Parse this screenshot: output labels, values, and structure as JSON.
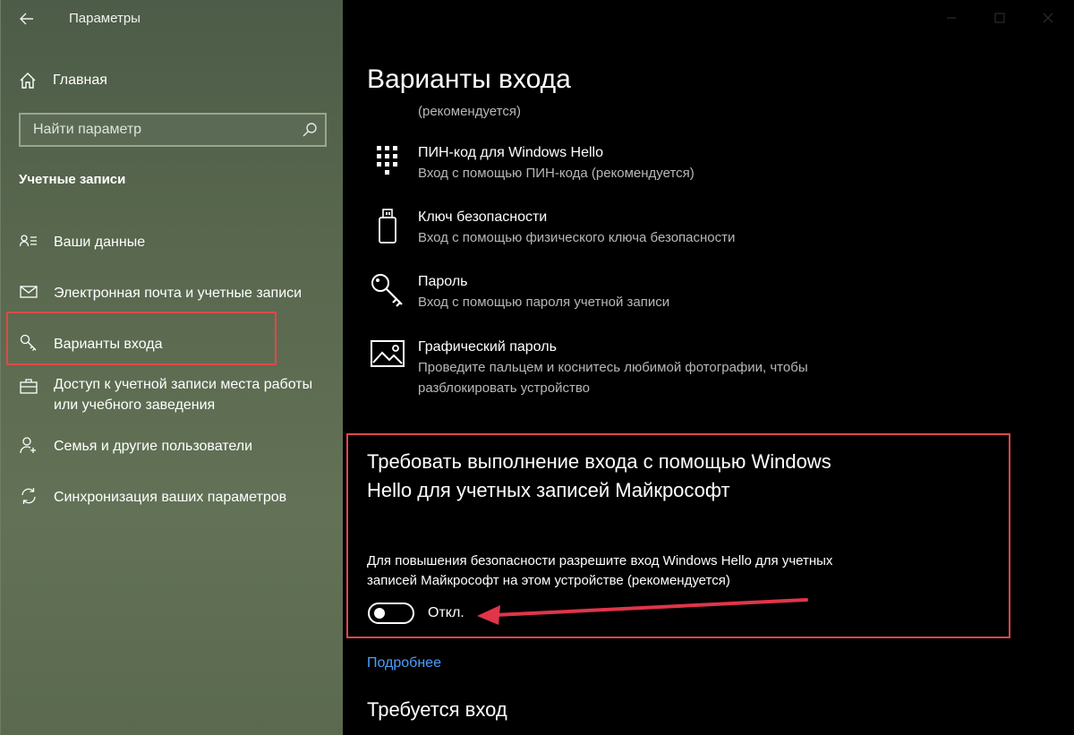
{
  "window": {
    "title": "Параметры"
  },
  "sidebar": {
    "home_label": "Главная",
    "search_placeholder": "Найти параметр",
    "section_title": "Учетные записи",
    "items": [
      {
        "label": "Ваши данные",
        "icon": "person-card-icon"
      },
      {
        "label": "Электронная почта и учетные записи",
        "icon": "mail-icon"
      },
      {
        "label": "Варианты входа",
        "icon": "key-icon",
        "selected": true
      },
      {
        "label": "Доступ к учетной записи места работы или учебного заведения",
        "icon": "briefcase-icon"
      },
      {
        "label": "Семья и другие пользователи",
        "icon": "person-add-icon"
      },
      {
        "label": "Синхронизация ваших параметров",
        "icon": "sync-icon"
      }
    ]
  },
  "main": {
    "title": "Варианты входа",
    "recommended_text": "(рекомендуется)",
    "options": [
      {
        "title": "ПИН-код для Windows Hello",
        "desc": "Вход с помощью ПИН-кода (рекомендуется)",
        "icon": "keypad-icon"
      },
      {
        "title": "Ключ безопасности",
        "desc": "Вход с помощью физического ключа безопасности",
        "icon": "usb-key-icon"
      },
      {
        "title": "Пароль",
        "desc": "Вход с помощью пароля учетной записи",
        "icon": "key-icon"
      },
      {
        "title": "Графический пароль",
        "desc": "Проведите пальцем и коснитесь любимой фотографии, чтобы разблокировать устройство",
        "icon": "picture-icon"
      }
    ],
    "hello": {
      "title": "Требовать выполнение входа с помощью Windows Hello для учетных записей Майкрософт",
      "desc": "Для повышения безопасности разрешите вход Windows Hello для учетных записей Майкрософт на этом устройстве (рекомендуется)",
      "toggle_label": "Откл.",
      "toggle_on": false
    },
    "more_link": "Подробнее",
    "required_title": "Требуется вход"
  },
  "colors": {
    "highlight_border": "#e04848",
    "link": "#4b9fff",
    "sidebar_bg": "#59684e"
  }
}
